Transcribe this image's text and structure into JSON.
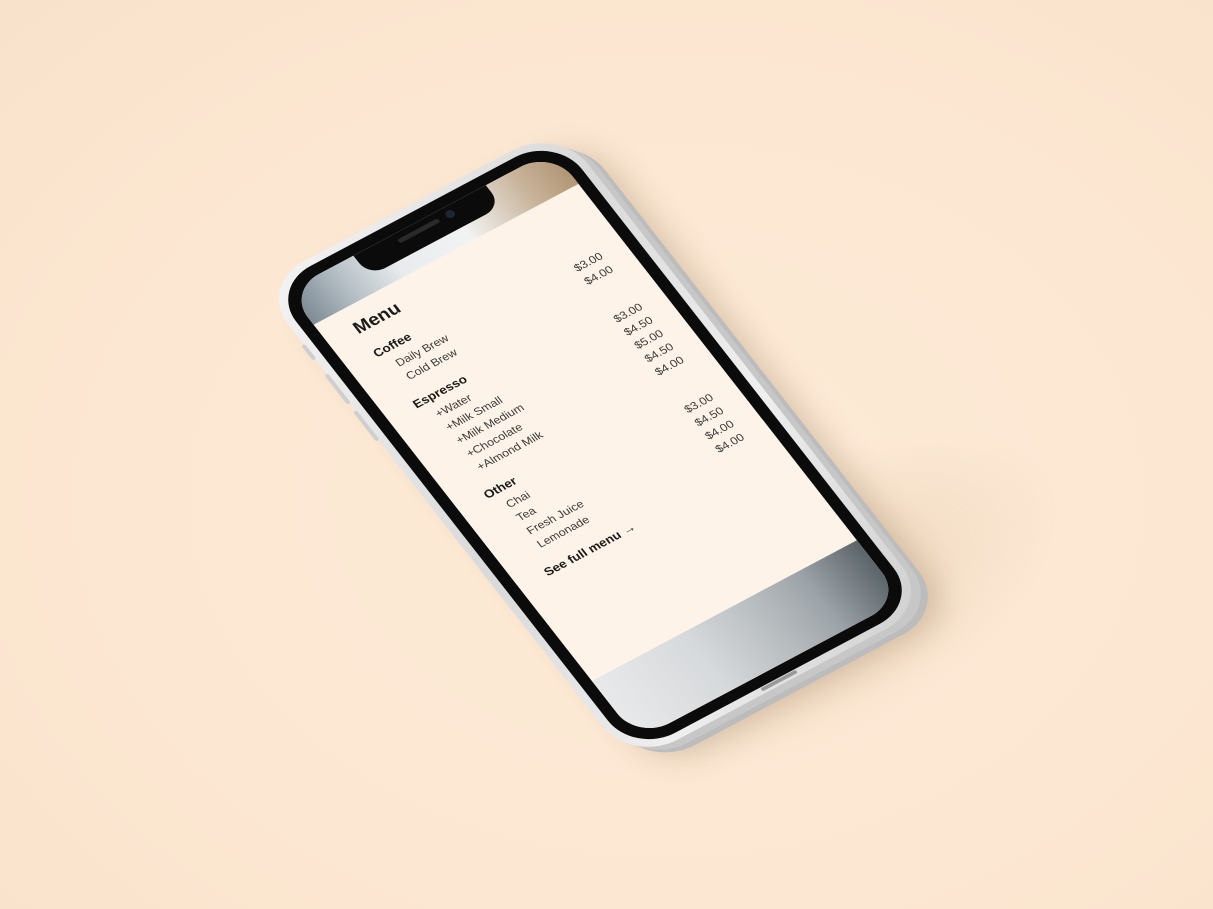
{
  "menu": {
    "title": "Menu",
    "sections": [
      {
        "title": "Coffee",
        "items": [
          {
            "name": "Daily Brew",
            "price": "$3.00"
          },
          {
            "name": "Cold Brew",
            "price": "$4.00"
          }
        ]
      },
      {
        "title": "Espresso",
        "items": [
          {
            "name": "+Water",
            "price": "$3.00"
          },
          {
            "name": "+Milk Small",
            "price": "$4.50"
          },
          {
            "name": "+Milk Medium",
            "price": "$5.00"
          },
          {
            "name": "+Chocolate",
            "price": "$4.50"
          },
          {
            "name": "+Almond Milk",
            "price": "$4.00"
          }
        ]
      },
      {
        "title": "Other",
        "items": [
          {
            "name": "Chai",
            "price": "$3.00"
          },
          {
            "name": "Tea",
            "price": "$4.50"
          },
          {
            "name": "Fresh Juice",
            "price": "$4.00"
          },
          {
            "name": "Lemonade",
            "price": "$4.00"
          }
        ]
      }
    ],
    "full_menu_link": "See full menu →"
  },
  "colors": {
    "background": "#fdebd7",
    "screen": "#fdf3e8",
    "text": "#1a1a1a"
  }
}
